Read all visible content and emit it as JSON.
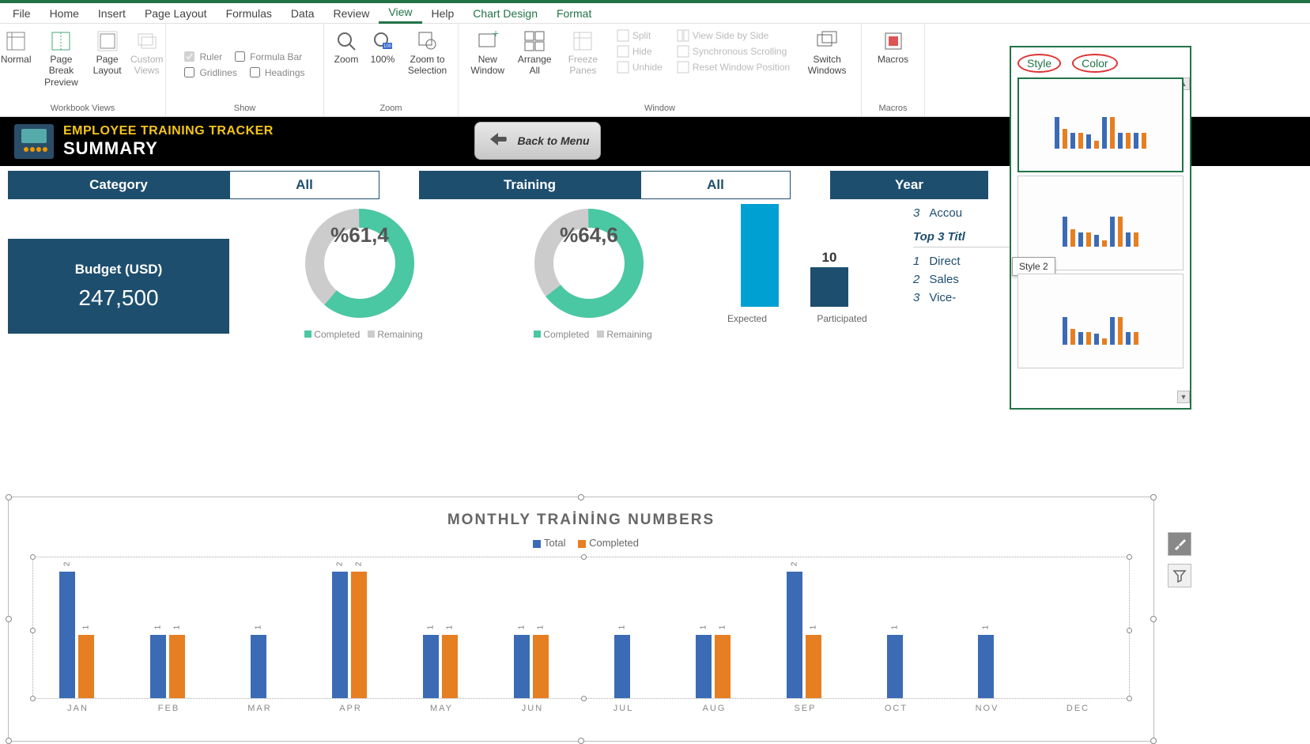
{
  "menu": {
    "file": "File",
    "home": "Home",
    "insert": "Insert",
    "page_layout": "Page Layout",
    "formulas": "Formulas",
    "data": "Data",
    "review": "Review",
    "view": "View",
    "help": "Help",
    "chart_design": "Chart Design",
    "format": "Format"
  },
  "ribbon": {
    "workbook_views": {
      "label": "Workbook Views",
      "normal": "Normal",
      "page_break": "Page Break Preview",
      "page_layout": "Page Layout",
      "custom": "Custom Views"
    },
    "show": {
      "label": "Show",
      "ruler": "Ruler",
      "formula_bar": "Formula Bar",
      "gridlines": "Gridlines",
      "headings": "Headings"
    },
    "zoom": {
      "label": "Zoom",
      "zoom": "Zoom",
      "hundred": "100%",
      "selection": "Zoom to Selection"
    },
    "window": {
      "label": "Window",
      "new": "New Window",
      "arrange": "Arrange All",
      "freeze": "Freeze Panes",
      "split": "Split",
      "hide": "Hide",
      "unhide": "Unhide",
      "side": "View Side by Side",
      "sync": "Synchronous Scrolling",
      "reset": "Reset Window Position",
      "switch": "Switch Windows"
    },
    "macros": {
      "label": "Macros",
      "macros": "Macros"
    }
  },
  "dash": {
    "title1": "EMPLOYEE TRAINING TRACKER",
    "title2": "SUMMARY",
    "back": "Back to Menu",
    "filters": {
      "category": "Category",
      "category_v": "All",
      "training": "Training",
      "training_v": "All",
      "year": "Year"
    },
    "budget": {
      "label": "Budget (USD)",
      "value": "247,500"
    },
    "donut1": {
      "pct": "%61,4",
      "completed": "Completed",
      "remaining": "Remaining"
    },
    "donut2": {
      "pct": "%64,6",
      "completed": "Completed",
      "remaining": "Remaining"
    },
    "bars": {
      "expected": "Expected",
      "participated": "Participated",
      "v_participated": "10"
    },
    "top3": {
      "row1": {
        "n": "3",
        "t": "Accou"
      },
      "hdr": "Top 3 Titl",
      "r1": {
        "n": "1",
        "t": "Direct"
      },
      "r2": {
        "n": "2",
        "t": "Sales"
      },
      "r3": {
        "n": "3",
        "t": "Vice-"
      }
    }
  },
  "chart_data": {
    "type": "bar",
    "title": "MONTHLY TRAİNİNG NUMBERS",
    "series": [
      {
        "name": "Total",
        "color": "#3b6bb5"
      },
      {
        "name": "Completed",
        "color": "#e67e22"
      }
    ],
    "categories": [
      "JAN",
      "FEB",
      "MAR",
      "APR",
      "MAY",
      "JUN",
      "JUL",
      "AUG",
      "SEP",
      "OCT",
      "NOV",
      "DEC"
    ],
    "total": [
      2,
      1,
      1,
      2,
      1,
      1,
      1,
      1,
      2,
      1,
      1,
      0
    ],
    "completed": [
      1,
      1,
      0,
      2,
      1,
      1,
      0,
      1,
      1,
      0,
      0,
      0
    ],
    "ylim": [
      0,
      2
    ]
  },
  "stylepane": {
    "style": "Style",
    "color": "Color",
    "tooltip": "Style 2"
  }
}
